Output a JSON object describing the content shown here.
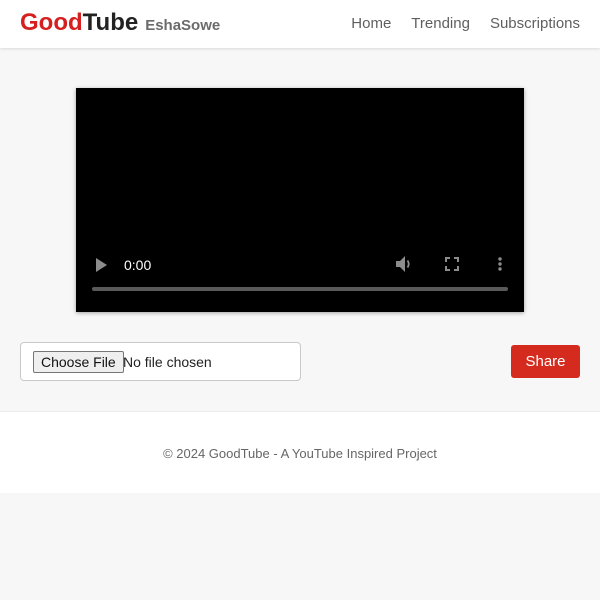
{
  "brand": {
    "good": "Good",
    "tube": "Tube",
    "username": "EshaSowe"
  },
  "nav": {
    "items": [
      "Home",
      "Trending",
      "Subscriptions"
    ]
  },
  "player": {
    "current_time": "0:00",
    "progress": 0,
    "icons": [
      "play-icon",
      "volume-icon",
      "fullscreen-icon",
      "more-options-icon"
    ]
  },
  "upload": {
    "button_label": "Choose File",
    "status": "No file chosen"
  },
  "share": {
    "label": "Share"
  },
  "footer": {
    "text": "© 2024 GoodTube - A YouTube Inspired Project"
  },
  "colors": {
    "brand_red": "#d61f1f",
    "share_red": "#d52b1e",
    "background": "#f7f7f7"
  }
}
